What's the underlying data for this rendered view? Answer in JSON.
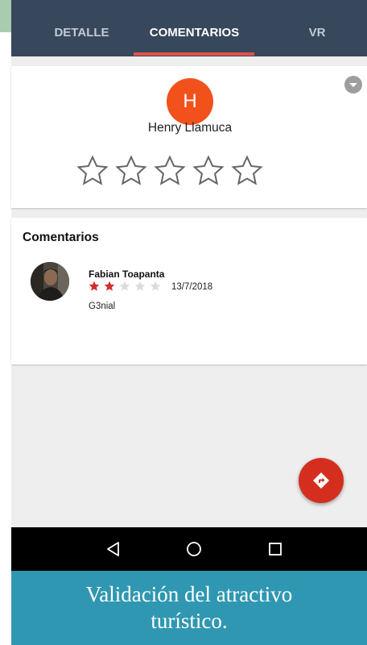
{
  "tabs": [
    {
      "label": "DETALLE",
      "active": false
    },
    {
      "label": "COMENTARIOS",
      "active": true
    },
    {
      "label": "VR",
      "active": false
    }
  ],
  "user_card": {
    "avatar_initial": "H",
    "avatar_color": "#f2511b",
    "name": "Henry Llamuca",
    "rating_input_stars": 5,
    "rating_selected": 0,
    "options_icon": "chevron-down-circle-icon"
  },
  "comments": {
    "title": "Comentarios",
    "items": [
      {
        "author": "Fabian Toapanta",
        "rating": 2,
        "rating_max": 5,
        "date": "13/7/2018",
        "text": "G3nial"
      }
    ]
  },
  "fab": {
    "icon": "directions-icon",
    "color": "#d42f1e"
  },
  "system_nav": {
    "back_icon": "back-triangle-icon",
    "home_icon": "home-circle-icon",
    "recents_icon": "recents-square-icon"
  },
  "caption": {
    "line1": "Validación del atractivo",
    "line2": "turístico."
  },
  "colors": {
    "tabbar": "#37475c",
    "tab_indicator": "#e05446",
    "star_filled": "#d32f2f",
    "star_empty": "#dcdcdc",
    "caption_bg": "#2f97b1"
  }
}
